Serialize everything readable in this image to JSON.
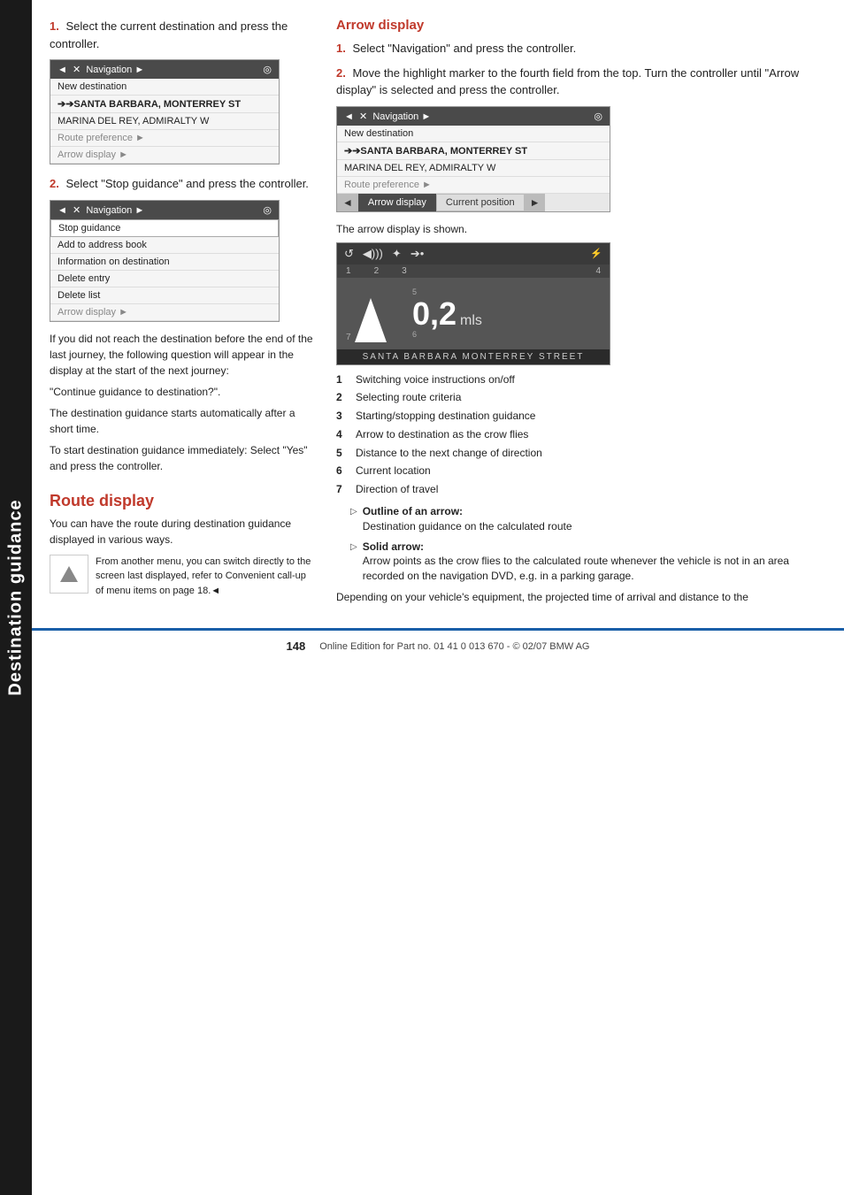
{
  "sidebar": {
    "title": "Destination guidance"
  },
  "left_col": {
    "step1_text": "Select the current destination and press the controller.",
    "nav_menu_1": {
      "header": "◄  ✕  Navigation ►",
      "items": [
        {
          "label": "New destination",
          "type": "normal"
        },
        {
          "label": "➔➔SANTA BARBARA, MONTERREY ST",
          "type": "bold"
        },
        {
          "label": "MARINA DEL REY, ADMIRALTY W",
          "type": "normal"
        },
        {
          "label": "Route preference ►",
          "type": "light"
        },
        {
          "label": "Arrow display ►",
          "type": "light"
        }
      ]
    },
    "step2_text": "Select \"Stop guidance\" and press the controller.",
    "nav_menu_2": {
      "header": "◄  ✕  Navigation ►",
      "items": [
        {
          "label": "Stop guidance",
          "type": "selected"
        },
        {
          "label": "Add to address book",
          "type": "normal"
        },
        {
          "label": "Information on destination",
          "type": "normal"
        },
        {
          "label": "Delete entry",
          "type": "normal"
        },
        {
          "label": "Delete list",
          "type": "normal"
        },
        {
          "label": "Arrow display ►",
          "type": "normal"
        }
      ]
    },
    "para1": "If you did not reach the destination before the end of the last journey, the following question will appear in the display at the start of the next journey:",
    "para2": "\"Continue guidance to destination?\".",
    "para3": "The destination guidance starts automatically after a short time.",
    "para4": "To start destination guidance immediately: Select \"Yes\" and press the controller.",
    "route_heading": "Route display",
    "route_text1": "You can have the route during destination guidance displayed in various ways.",
    "icon_text": "From another menu, you can switch directly to the screen last displayed, refer to Convenient call-up of menu items on page 18.◄"
  },
  "right_col": {
    "arrow_heading": "Arrow display",
    "step1_text": "Select \"Navigation\" and press the controller.",
    "step2_text": "Move the highlight marker to the fourth field from the top. Turn the controller until \"Arrow display\" is selected and press the controller.",
    "nav_menu": {
      "header": "◄  ✕  Navigation ►",
      "items": [
        {
          "label": "New destination"
        },
        {
          "label": "➔➔SANTA BARBARA, MONTERREY ST"
        },
        {
          "label": "MARINA DEL REY, ADMIRALTY W"
        },
        {
          "label": "Route preference ►"
        },
        {
          "label": "Arrow display | Current position ►",
          "type": "arrow-row"
        }
      ]
    },
    "arrow_shown_text": "The arrow display is shown.",
    "diagram": {
      "icons": [
        "↺",
        "◀)))",
        "✦",
        "➔•",
        "⚡"
      ],
      "numbers": [
        "1",
        "2",
        "3",
        "4"
      ],
      "arrow_label": "7",
      "distance": "0,2",
      "unit": "mls",
      "street": "SANTA BARBARA MONTERREY STREET",
      "num5": "5",
      "num6": "6"
    },
    "numbered_items": [
      {
        "num": "1",
        "text": "Switching voice instructions on/off"
      },
      {
        "num": "2",
        "text": "Selecting route criteria"
      },
      {
        "num": "3",
        "text": "Starting/stopping destination guidance"
      },
      {
        "num": "4",
        "text": "Arrow to destination as the crow flies"
      },
      {
        "num": "5",
        "text": "Distance to the next change of direction"
      },
      {
        "num": "6",
        "text": "Current location"
      },
      {
        "num": "7",
        "text": "Direction of travel"
      }
    ],
    "sub_items": [
      {
        "bullet": "▷",
        "label": "Outline of an arrow:",
        "text": "Destination guidance on the calculated route"
      },
      {
        "bullet": "▷",
        "label": "Solid arrow:",
        "text": "Arrow points as the crow flies to the calculated route whenever the vehicle is not in an area recorded on the navigation DVD, e.g. in a parking garage."
      }
    ],
    "footer_text": "Depending on your vehicle's equipment, the projected time of arrival and distance to the"
  },
  "footer": {
    "page": "148",
    "text": "Online Edition for Part no. 01 41 0 013 670 - © 02/07 BMW AG"
  }
}
